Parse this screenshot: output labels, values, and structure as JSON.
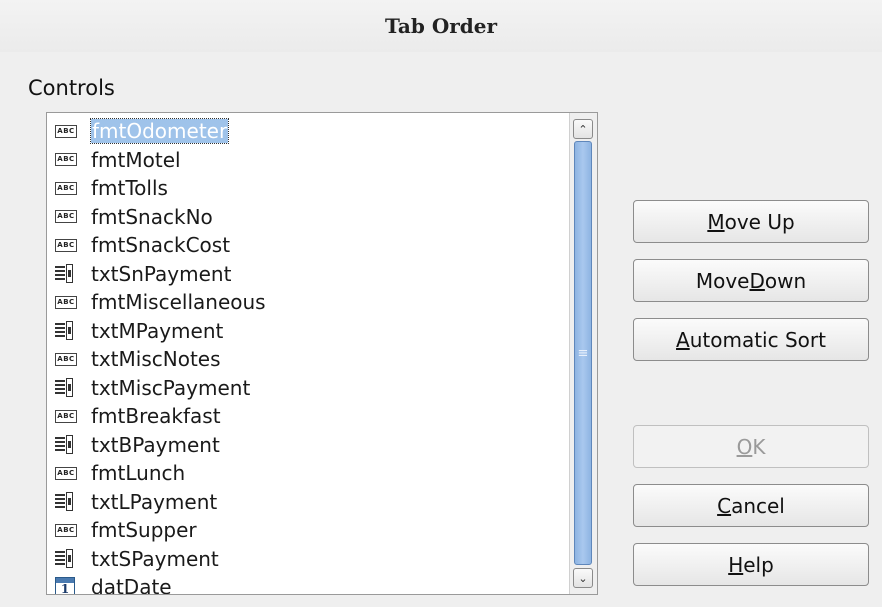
{
  "window": {
    "title": "Tab Order"
  },
  "controls": {
    "label": "Controls",
    "items": [
      {
        "icon": "text-field-icon",
        "label": "fmtOdometer",
        "selected": true
      },
      {
        "icon": "text-field-icon",
        "label": "fmtMotel"
      },
      {
        "icon": "text-field-icon",
        "label": "fmtTolls"
      },
      {
        "icon": "text-field-icon",
        "label": "fmtSnackNo"
      },
      {
        "icon": "text-field-icon",
        "label": "fmtSnackCost"
      },
      {
        "icon": "list-box-icon",
        "label": "txtSnPayment"
      },
      {
        "icon": "text-field-icon",
        "label": "fmtMiscellaneous"
      },
      {
        "icon": "list-box-icon",
        "label": "txtMPayment"
      },
      {
        "icon": "text-field-icon",
        "label": "txtMiscNotes"
      },
      {
        "icon": "list-box-icon",
        "label": "txtMiscPayment"
      },
      {
        "icon": "text-field-icon",
        "label": "fmtBreakfast"
      },
      {
        "icon": "list-box-icon",
        "label": "txtBPayment"
      },
      {
        "icon": "text-field-icon",
        "label": "fmtLunch"
      },
      {
        "icon": "list-box-icon",
        "label": "txtLPayment"
      },
      {
        "icon": "text-field-icon",
        "label": "fmtSupper"
      },
      {
        "icon": "list-box-icon",
        "label": "txtSPayment"
      },
      {
        "icon": "date-field-icon",
        "label": "datDate"
      }
    ]
  },
  "buttons": {
    "move_up": {
      "pre": "",
      "key": "M",
      "post": "ove Up"
    },
    "move_down": {
      "pre": "Move ",
      "key": "D",
      "post": "own"
    },
    "automatic_sort": {
      "pre": "",
      "key": "A",
      "post": "utomatic Sort"
    },
    "ok": {
      "pre": "",
      "key": "O",
      "post": "K",
      "disabled": true
    },
    "cancel": {
      "pre": "",
      "key": "C",
      "post": "ancel"
    },
    "help": {
      "pre": "",
      "key": "H",
      "post": "elp"
    }
  },
  "icons": {
    "text_field_text": "ABC",
    "date_field_text": "1"
  },
  "colors": {
    "selection": "#9fc3ea",
    "scroll_thumb": "#a9c8ee",
    "window_bg": "#efefef"
  }
}
